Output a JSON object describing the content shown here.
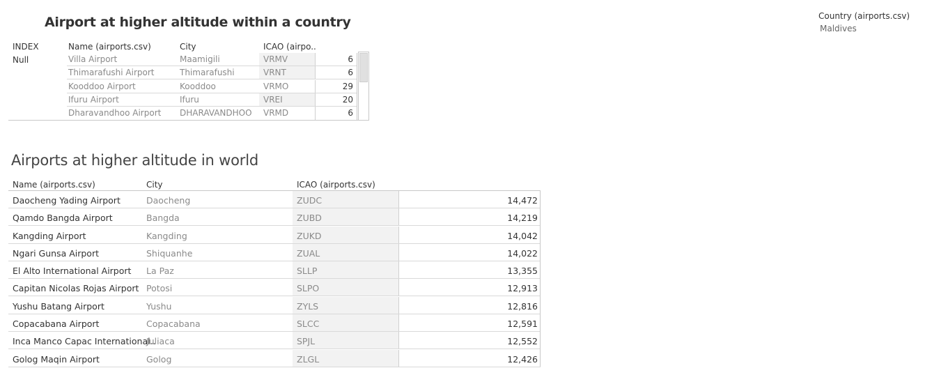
{
  "sheet1": {
    "title": "Airport at higher altitude within a country",
    "headers": {
      "index": "INDEX",
      "name": "Name (airports.csv)",
      "city": "City",
      "icao": "ICAO (airpo.."
    },
    "index_value": "Null",
    "rows": [
      {
        "name": "Villa Airport",
        "city": "Maamigili",
        "icao": "VRMV",
        "value": "6"
      },
      {
        "name": "Thimarafushi Airport",
        "city": "Thimarafushi",
        "icao": "VRNT",
        "value": "6"
      },
      {
        "name": "Kooddoo Airport",
        "city": "Kooddoo",
        "icao": "VRMO",
        "value": "29"
      },
      {
        "name": "Ifuru Airport",
        "city": "Ifuru",
        "icao": "VREI",
        "value": "20"
      },
      {
        "name": "Dharavandhoo Airport",
        "city": "DHARAVANDHOO",
        "icao": "VRMD",
        "value": "6"
      }
    ]
  },
  "filter": {
    "title": "Country (airports.csv)",
    "value": "Maldives"
  },
  "sheet2": {
    "title": "Airports at higher altitude in world",
    "headers": {
      "name": "Name (airports.csv)",
      "city": "City",
      "icao": "ICAO (airports.csv)"
    },
    "rows": [
      {
        "name": "Daocheng Yading Airport",
        "city": "Daocheng",
        "icao": "ZUDC",
        "value": "14,472"
      },
      {
        "name": "Qamdo Bangda Airport",
        "city": "Bangda",
        "icao": "ZUBD",
        "value": "14,219"
      },
      {
        "name": "Kangding Airport",
        "city": "Kangding",
        "icao": "ZUKD",
        "value": "14,042"
      },
      {
        "name": "Ngari Gunsa Airport",
        "city": "Shiquanhe",
        "icao": "ZUAL",
        "value": "14,022"
      },
      {
        "name": "El Alto International Airport",
        "city": "La Paz",
        "icao": "SLLP",
        "value": "13,355"
      },
      {
        "name": "Capitan Nicolas Rojas Airport",
        "city": "Potosi",
        "icao": "SLPO",
        "value": "12,913"
      },
      {
        "name": "Yushu Batang Airport",
        "city": "Yushu",
        "icao": "ZYLS",
        "value": "12,816"
      },
      {
        "name": "Copacabana Airport",
        "city": "Copacabana",
        "icao": "SLCC",
        "value": "12,591"
      },
      {
        "name": "Inca Manco Capac International..",
        "city": "Juliaca",
        "icao": "SPJL",
        "value": "12,552"
      },
      {
        "name": "Golog Maqin Airport",
        "city": "Golog",
        "icao": "ZLGL",
        "value": "12,426"
      }
    ]
  }
}
